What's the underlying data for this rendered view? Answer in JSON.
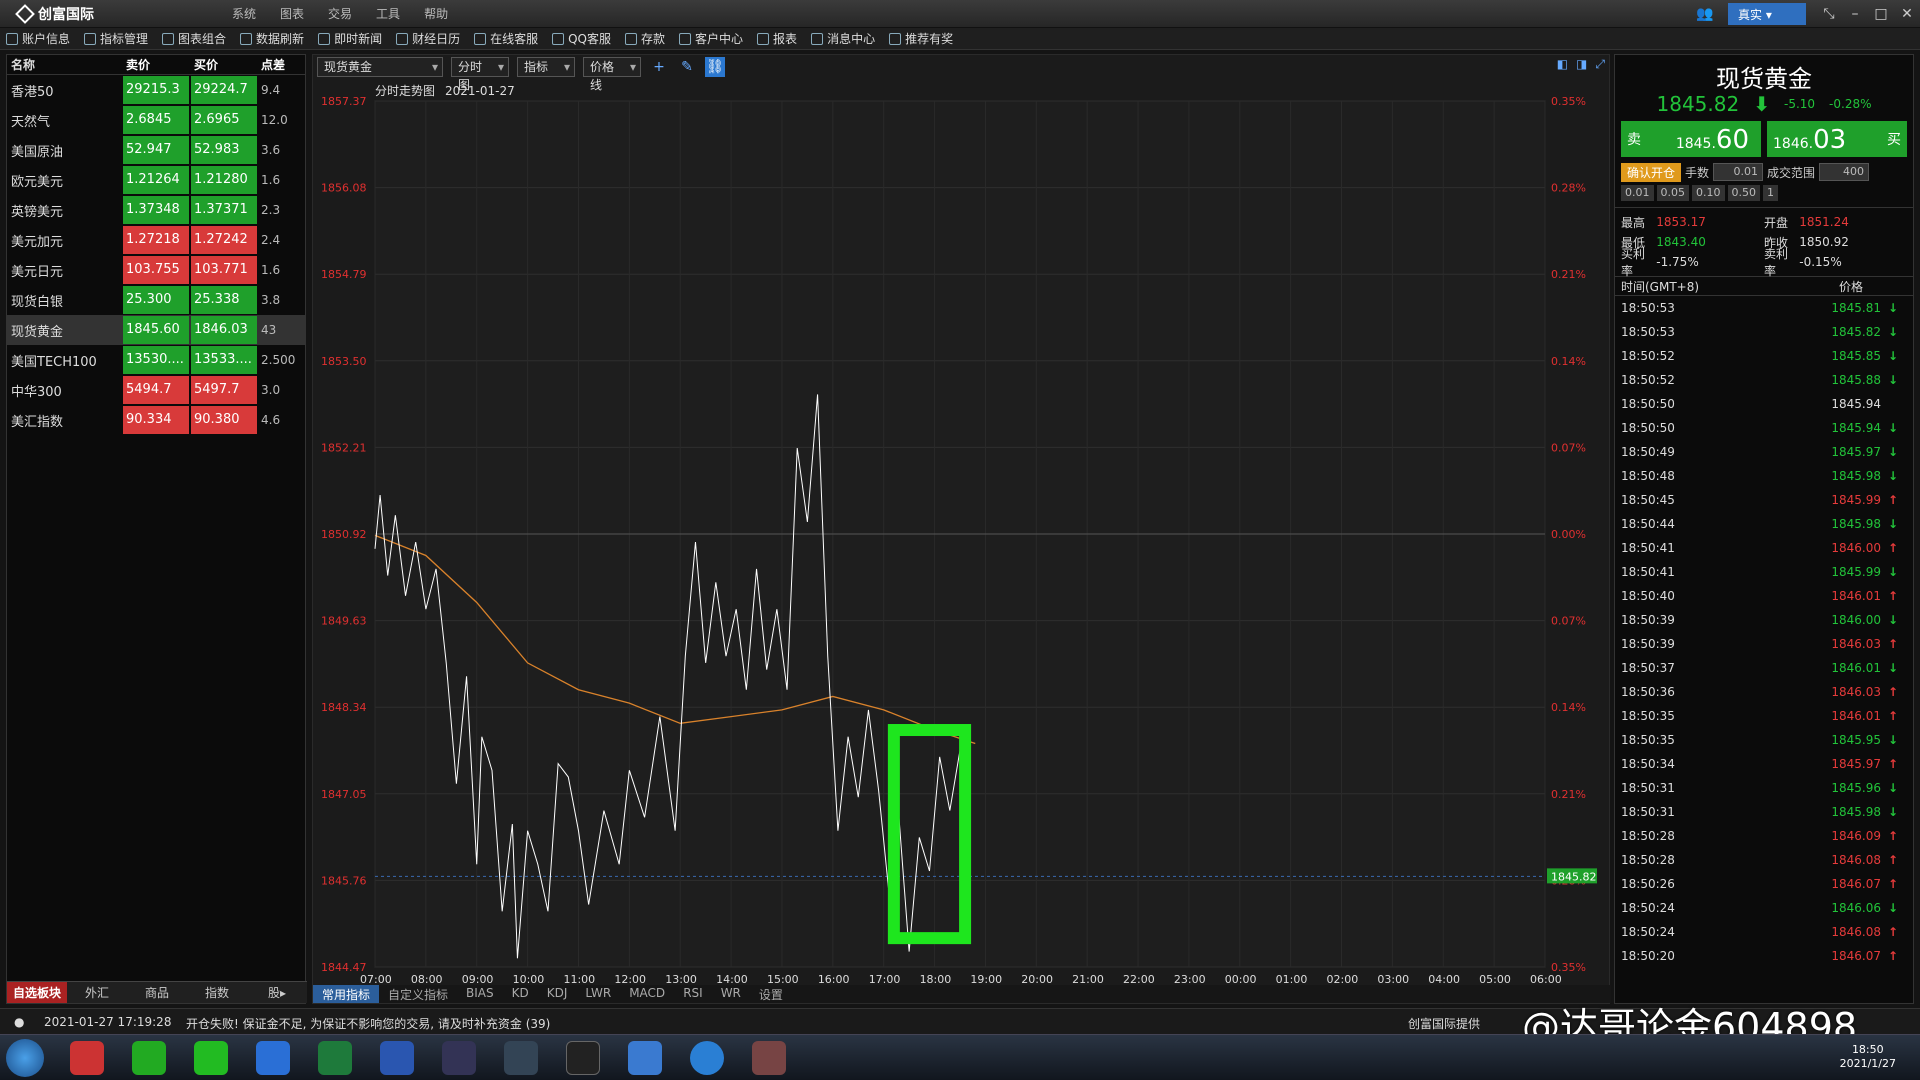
{
  "app": {
    "title": "创富国际",
    "account_mode": "真实",
    "menu": [
      "系统",
      "图表",
      "交易",
      "工具",
      "帮助"
    ]
  },
  "toolbar": [
    "账户信息",
    "指标管理",
    "图表组合",
    "数据刷新",
    "即时新闻",
    "财经日历",
    "在线客服",
    "QQ客服",
    "存款",
    "客户中心",
    "报表",
    "消息中心",
    "推荐有奖"
  ],
  "watchlist": {
    "headers": [
      "名称",
      "卖价",
      "买价",
      "点差"
    ],
    "rows": [
      {
        "name": "香港50",
        "bid": "29215.3",
        "ask": "29224.7",
        "spread": "9.4",
        "color": "g"
      },
      {
        "name": "天然气",
        "bid": "2.6845",
        "ask": "2.6965",
        "spread": "12.0",
        "color": "g"
      },
      {
        "name": "美国原油",
        "bid": "52.947",
        "ask": "52.983",
        "spread": "3.6",
        "color": "g"
      },
      {
        "name": "欧元美元",
        "bid": "1.21264",
        "ask": "1.21280",
        "spread": "1.6",
        "color": "g"
      },
      {
        "name": "英镑美元",
        "bid": "1.37348",
        "ask": "1.37371",
        "spread": "2.3",
        "color": "g"
      },
      {
        "name": "美元加元",
        "bid": "1.27218",
        "ask": "1.27242",
        "spread": "2.4",
        "color": "r"
      },
      {
        "name": "美元日元",
        "bid": "103.755",
        "ask": "103.771",
        "spread": "1.6",
        "color": "r"
      },
      {
        "name": "现货白银",
        "bid": "25.300",
        "ask": "25.338",
        "spread": "3.8",
        "color": "g"
      },
      {
        "name": "现货黄金",
        "bid": "1845.60",
        "ask": "1846.03",
        "spread": "43",
        "color": "g",
        "selected": true
      },
      {
        "name": "美国TECH100",
        "bid": "13530....",
        "ask": "13533....",
        "spread": "2.500",
        "color": "g"
      },
      {
        "name": "中华300",
        "bid": "5494.7",
        "ask": "5497.7",
        "spread": "3.0",
        "color": "r"
      },
      {
        "name": "美汇指数",
        "bid": "90.334",
        "ask": "90.380",
        "spread": "4.6",
        "color": "r"
      }
    ],
    "tabs": [
      "自选板块",
      "外汇",
      "商品",
      "指数",
      "股▸"
    ]
  },
  "chart_toolbar": {
    "symbol": "现货黄金",
    "period": "分时图",
    "indicator": "指标",
    "line_type": "价格线"
  },
  "indicator_tabs": [
    "常用指标",
    "自定义指标",
    "BIAS",
    "KD",
    "KDJ",
    "LWR",
    "MACD",
    "RSI",
    "WR",
    "设置"
  ],
  "chart_data": {
    "type": "line",
    "title": "分时走势图",
    "date": "2021-01-27",
    "y_ticks": [
      "1857.37",
      "1856.08",
      "1854.79",
      "1853.50",
      "1852.21",
      "1850.92",
      "1849.63",
      "1848.34",
      "1847.05",
      "1845.76",
      "1844.47"
    ],
    "pct_ticks": [
      "0.35%",
      "0.28%",
      "0.21%",
      "0.14%",
      "0.07%",
      "0.00%",
      "0.07%",
      "0.14%",
      "0.21%",
      "0.28%",
      "0.35%"
    ],
    "x_ticks": [
      "07:00",
      "08:00",
      "09:00",
      "10:00",
      "11:00",
      "12:00",
      "13:00",
      "14:00",
      "15:00",
      "16:00",
      "17:00",
      "18:00",
      "19:00",
      "20:00",
      "21:00",
      "22:00",
      "23:00",
      "00:00",
      "01:00",
      "02:00",
      "03:00",
      "04:00",
      "05:00",
      "06:00"
    ],
    "ylim": [
      1844.47,
      1857.37
    ],
    "prev_close": 1850.92,
    "current_price": "1845.82",
    "price_series": {
      "x_hours": [
        0,
        0.1,
        0.25,
        0.4,
        0.6,
        0.8,
        1.0,
        1.2,
        1.4,
        1.6,
        1.8,
        2.0,
        2.1,
        2.3,
        2.5,
        2.7,
        2.8,
        3.0,
        3.2,
        3.4,
        3.6,
        3.8,
        4.0,
        4.2,
        4.5,
        4.8,
        5.0,
        5.3,
        5.6,
        5.9,
        6.1,
        6.3,
        6.5,
        6.7,
        6.9,
        7.1,
        7.3,
        7.5,
        7.7,
        7.9,
        8.1,
        8.3,
        8.5,
        8.7,
        8.9,
        9.1,
        9.3,
        9.5,
        9.7,
        9.9,
        10.1,
        10.3,
        10.5,
        10.7,
        10.9,
        11.1,
        11.3,
        11.5,
        11.7
      ],
      "y": [
        1850.7,
        1851.5,
        1850.3,
        1851.2,
        1850.0,
        1850.8,
        1849.8,
        1850.4,
        1849.0,
        1847.2,
        1848.8,
        1846.0,
        1847.9,
        1847.4,
        1845.3,
        1846.6,
        1844.6,
        1846.5,
        1846.0,
        1845.3,
        1847.5,
        1847.3,
        1846.5,
        1845.4,
        1846.8,
        1846.0,
        1847.4,
        1846.7,
        1848.2,
        1846.5,
        1849.1,
        1850.8,
        1849.0,
        1850.2,
        1849.1,
        1849.8,
        1848.6,
        1850.4,
        1848.9,
        1849.8,
        1848.6,
        1852.2,
        1851.1,
        1853.0,
        1849.1,
        1846.5,
        1847.9,
        1847.0,
        1848.3,
        1847.1,
        1845.6,
        1846.7,
        1844.7,
        1846.4,
        1845.9,
        1847.6,
        1846.8,
        1847.7,
        1845.8
      ]
    },
    "avg_series": {
      "x_hours": [
        0,
        1,
        2,
        3,
        4,
        5,
        6,
        7,
        8,
        9,
        10,
        11,
        11.8
      ],
      "y": [
        1850.9,
        1850.6,
        1849.9,
        1849.0,
        1848.6,
        1848.4,
        1848.1,
        1848.2,
        1848.3,
        1848.5,
        1848.3,
        1848.0,
        1847.8
      ]
    },
    "highlight": {
      "x_hours": [
        10.2,
        11.6
      ],
      "y": [
        1844.9,
        1848.0
      ],
      "color": "#1ee61e"
    }
  },
  "quote": {
    "name": "现货黄金",
    "last": "1845.82",
    "change": "-5.10",
    "pct": "-0.28%",
    "sell_label": "卖",
    "sell_small": "1845.",
    "sell_big": "60",
    "buy_label": "买",
    "buy_small": "1846.",
    "buy_big": "03"
  },
  "order": {
    "confirm": "确认开仓",
    "lots_label": "手数",
    "lots_value": "0.01",
    "range_label": "成交范围",
    "range_value": "400",
    "presets": [
      "0.01",
      "0.05",
      "0.10",
      "0.50",
      "1"
    ]
  },
  "stats": {
    "high_label": "最高",
    "high": "1853.17",
    "open_label": "开盘",
    "open": "1851.24",
    "low_label": "最低",
    "low": "1843.40",
    "prev_label": "昨收",
    "prev": "1850.92",
    "buyrate_label": "买利率",
    "buyrate": "-1.75%",
    "sellrate_label": "卖利率",
    "sellrate": "-0.15%"
  },
  "ticks": {
    "headers": [
      "时间(GMT+8)",
      "价格"
    ],
    "rows": [
      {
        "t": "18:50:53",
        "p": "1845.81",
        "d": "down"
      },
      {
        "t": "18:50:53",
        "p": "1845.82",
        "d": "down"
      },
      {
        "t": "18:50:52",
        "p": "1845.85",
        "d": "down"
      },
      {
        "t": "18:50:52",
        "p": "1845.88",
        "d": "down"
      },
      {
        "t": "18:50:50",
        "p": "1845.94",
        "d": "none"
      },
      {
        "t": "18:50:50",
        "p": "1845.94",
        "d": "down"
      },
      {
        "t": "18:50:49",
        "p": "1845.97",
        "d": "down"
      },
      {
        "t": "18:50:48",
        "p": "1845.98",
        "d": "down"
      },
      {
        "t": "18:50:45",
        "p": "1845.99",
        "d": "up"
      },
      {
        "t": "18:50:44",
        "p": "1845.98",
        "d": "down"
      },
      {
        "t": "18:50:41",
        "p": "1846.00",
        "d": "up"
      },
      {
        "t": "18:50:41",
        "p": "1845.99",
        "d": "down"
      },
      {
        "t": "18:50:40",
        "p": "1846.01",
        "d": "up"
      },
      {
        "t": "18:50:39",
        "p": "1846.00",
        "d": "down"
      },
      {
        "t": "18:50:39",
        "p": "1846.03",
        "d": "up"
      },
      {
        "t": "18:50:37",
        "p": "1846.01",
        "d": "down"
      },
      {
        "t": "18:50:36",
        "p": "1846.03",
        "d": "up"
      },
      {
        "t": "18:50:35",
        "p": "1846.01",
        "d": "up"
      },
      {
        "t": "18:50:35",
        "p": "1845.95",
        "d": "down"
      },
      {
        "t": "18:50:34",
        "p": "1845.97",
        "d": "up"
      },
      {
        "t": "18:50:31",
        "p": "1845.96",
        "d": "down"
      },
      {
        "t": "18:50:31",
        "p": "1845.98",
        "d": "down"
      },
      {
        "t": "18:50:28",
        "p": "1846.09",
        "d": "up"
      },
      {
        "t": "18:50:28",
        "p": "1846.08",
        "d": "up"
      },
      {
        "t": "18:50:26",
        "p": "1846.07",
        "d": "up"
      },
      {
        "t": "18:50:24",
        "p": "1846.06",
        "d": "down"
      },
      {
        "t": "18:50:24",
        "p": "1846.08",
        "d": "up"
      },
      {
        "t": "18:50:20",
        "p": "1846.07",
        "d": "up"
      }
    ]
  },
  "status": {
    "time": "2021-01-27 17:19:28",
    "message": "开仓失败! 保证金不足, 为保证不影响您的交易, 请及时补充资金 (39)",
    "provider": "创富国际提供"
  },
  "watermark": "@达哥论金604898",
  "clock": {
    "time": "18:50",
    "date": "2021/1/27"
  }
}
